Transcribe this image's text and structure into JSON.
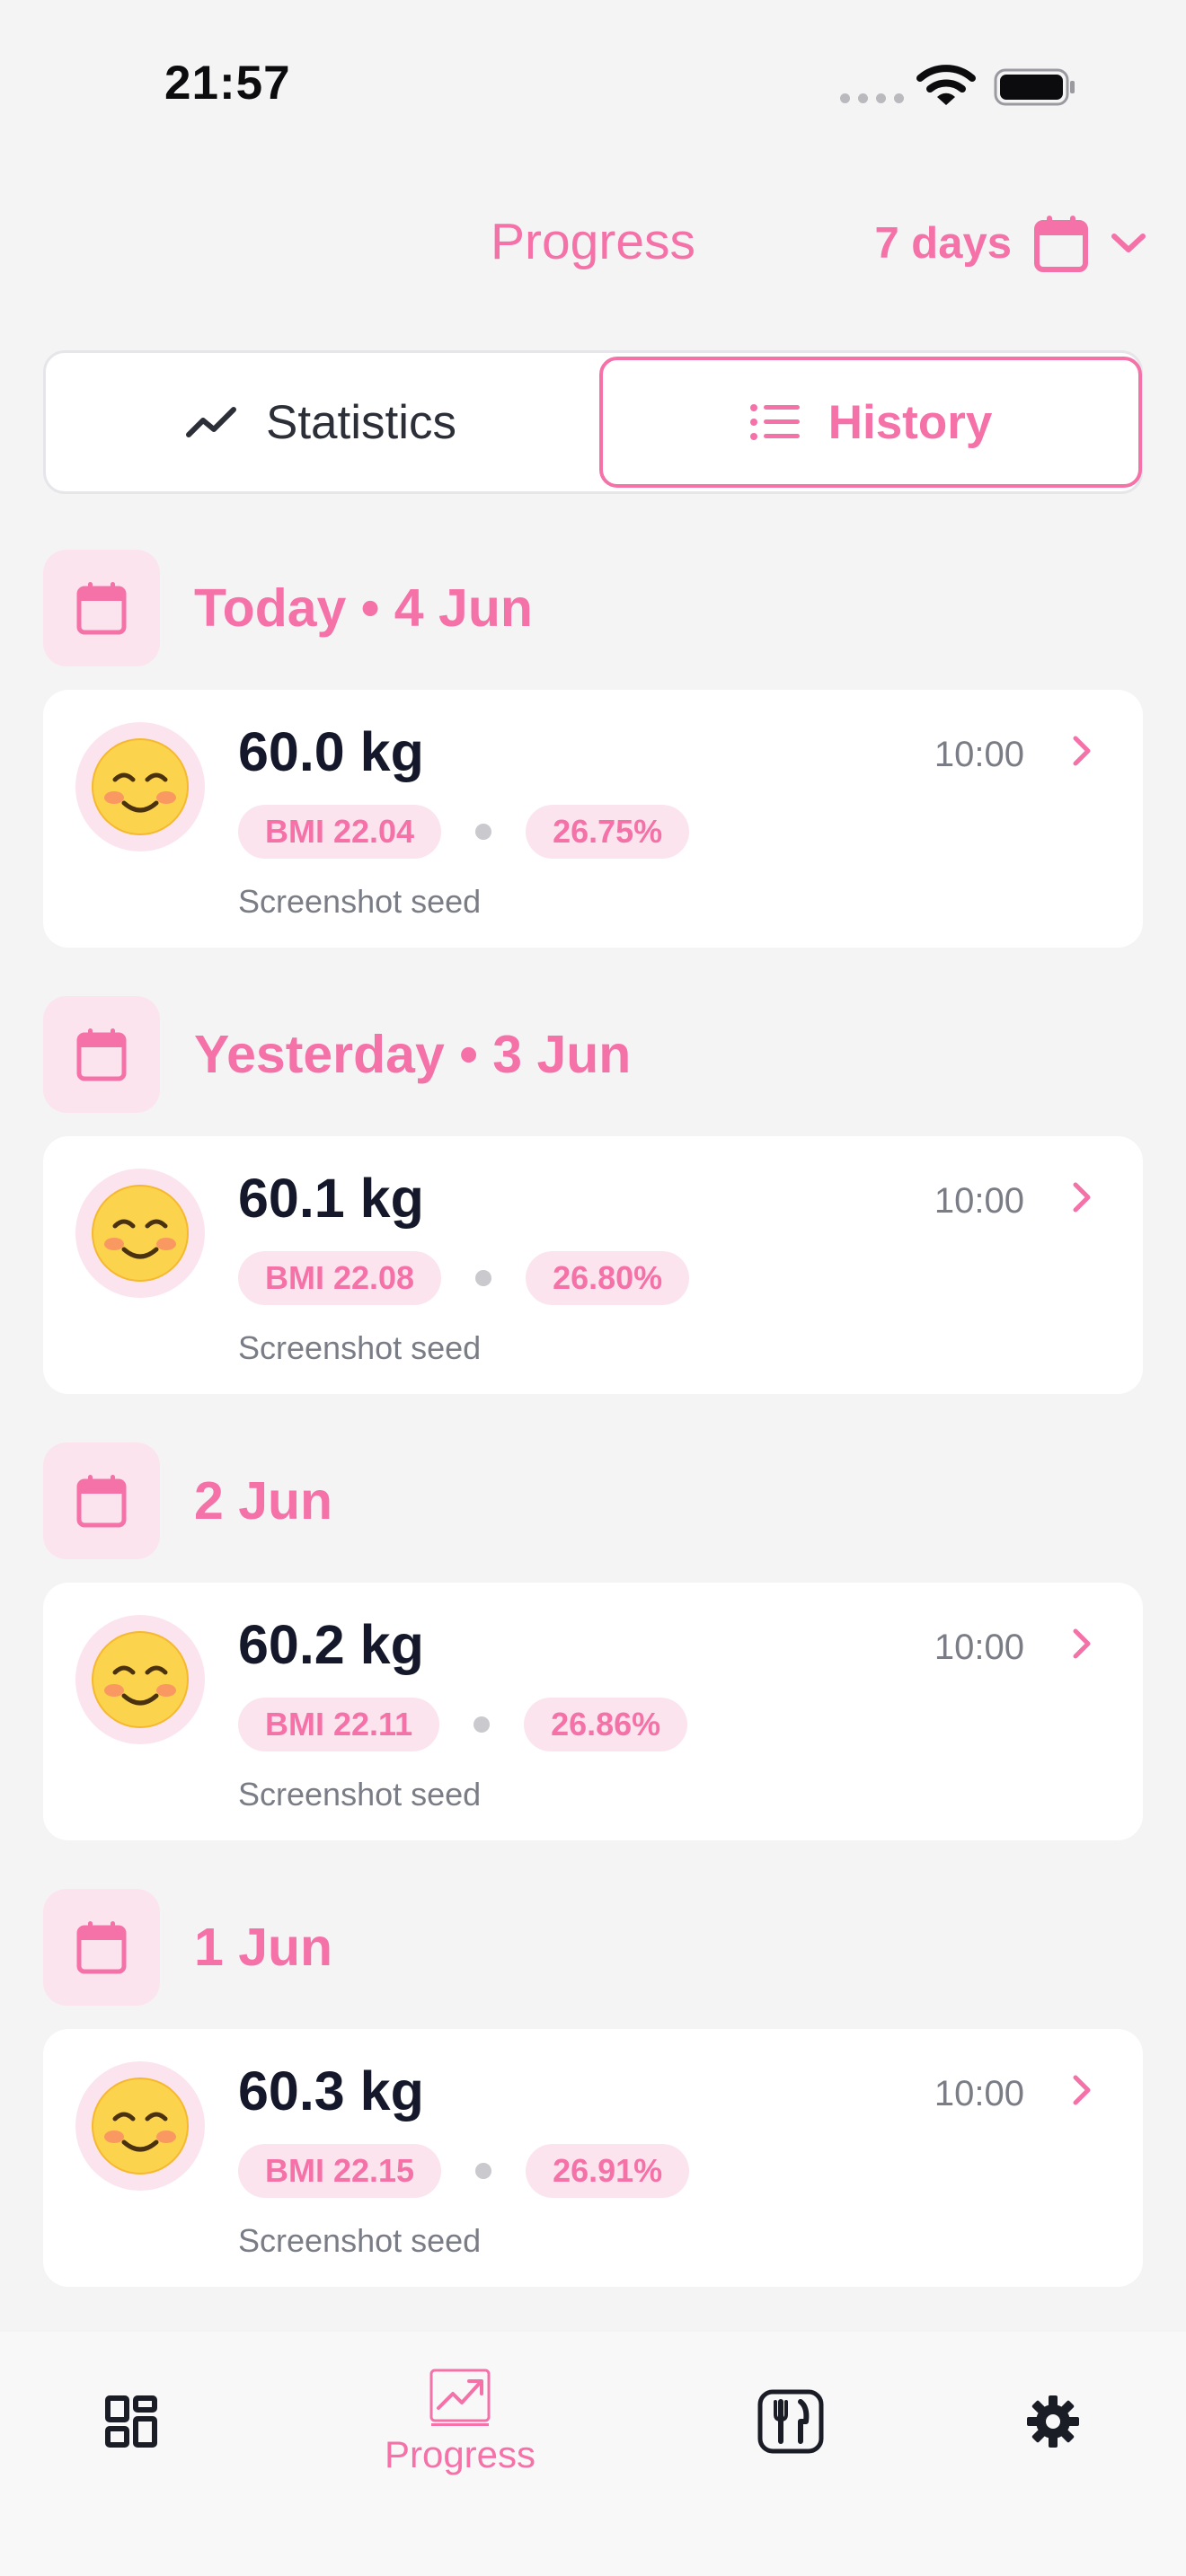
{
  "status_bar": {
    "time": "21:57"
  },
  "header": {
    "title": "Progress",
    "range_label": "7 days"
  },
  "tabs": [
    {
      "label": "Statistics",
      "selected": false
    },
    {
      "label": "History",
      "selected": true
    }
  ],
  "history": [
    {
      "date_label": "Today • 4 Jun",
      "weight": "60.0 kg",
      "time": "10:00",
      "bmi": "BMI 22.04",
      "body_fat": "26.75%",
      "note": "Screenshot seed",
      "mood_icon": "smiling-face-icon"
    },
    {
      "date_label": "Yesterday • 3 Jun",
      "weight": "60.1 kg",
      "time": "10:00",
      "bmi": "BMI 22.08",
      "body_fat": "26.80%",
      "note": "Screenshot seed",
      "mood_icon": "smiling-face-icon"
    },
    {
      "date_label": "2 Jun",
      "weight": "60.2 kg",
      "time": "10:00",
      "bmi": "BMI 22.11",
      "body_fat": "26.86%",
      "note": "Screenshot seed",
      "mood_icon": "smiling-face-icon"
    },
    {
      "date_label": "1 Jun",
      "weight": "60.3 kg",
      "time": "10:00",
      "bmi": "BMI 22.15",
      "body_fat": "26.91%",
      "note": "Screenshot seed",
      "mood_icon": "smiling-face-icon"
    }
  ],
  "bottom_nav": [
    {
      "icon": "dashboard-grid-icon",
      "label": "",
      "active": false
    },
    {
      "icon": "progress-chart-icon",
      "label": "Progress",
      "active": true
    },
    {
      "icon": "fork-knife-icon",
      "label": "",
      "active": false
    },
    {
      "icon": "gear-icon",
      "label": "",
      "active": false
    }
  ],
  "colors": {
    "accent": "#f472a8",
    "accent_soft": "#fce4ee",
    "background": "#f4f4f5",
    "text_dark": "#15182a",
    "text_muted": "#7a7c86"
  }
}
